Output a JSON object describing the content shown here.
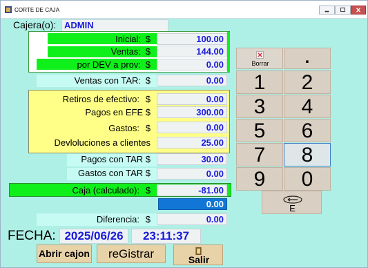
{
  "window": {
    "title": "CORTE DE CAJA"
  },
  "header": {
    "cajero_label": "Cajera(o):",
    "cajero_value": "ADMIN"
  },
  "summary": {
    "inicial_label": "Inicial:",
    "inicial_value": "100.00",
    "ventas_label": "Ventas:",
    "ventas_value": "144.00",
    "dev_label": "por DEV a prov:",
    "dev_value": "0.00",
    "ventas_tar_label": "Ventas con TAR:",
    "ventas_tar_value": "0.00",
    "retiros_label": "Retiros de efectivo:",
    "retiros_value": "0.00",
    "pagos_efe_label": "Pagos en EFE $",
    "pagos_efe_value": "300.00",
    "gastos_label": "Gastos:",
    "gastos_value": "0.00",
    "devol_label": "Devloluciones a clientes",
    "devol_value": "25.00",
    "pagos_tar_label": "Pagos con TAR $",
    "pagos_tar_value": "30.00",
    "gastos_tar_label": "Gastos con TAR $",
    "gastos_tar_value": "0.00",
    "caja_label": "Caja (calculado):",
    "caja_value": "-81.00",
    "entrada_value": "0.00",
    "diferencia_label": "Diferencia:",
    "diferencia_value": "0.00",
    "currency": "$"
  },
  "fecha": {
    "label": "FECHA:",
    "date": "2025/06/26",
    "time": "23:11:37"
  },
  "keypad": {
    "borrar_label": "Borrar",
    "dot_label": ".",
    "keys": [
      "1",
      "2",
      "3",
      "4",
      "5",
      "6",
      "7",
      "8",
      "9",
      "0"
    ],
    "enter_label": "E"
  },
  "buttons": {
    "abrir": "Abrir cajon",
    "registrar": "reGistrar",
    "salir": "Salir"
  },
  "colors": {
    "accent_green": "#0ff01a",
    "value_blue": "#1a1adb",
    "panel_yellow": "#ffff88",
    "background": "#aef0e6"
  }
}
